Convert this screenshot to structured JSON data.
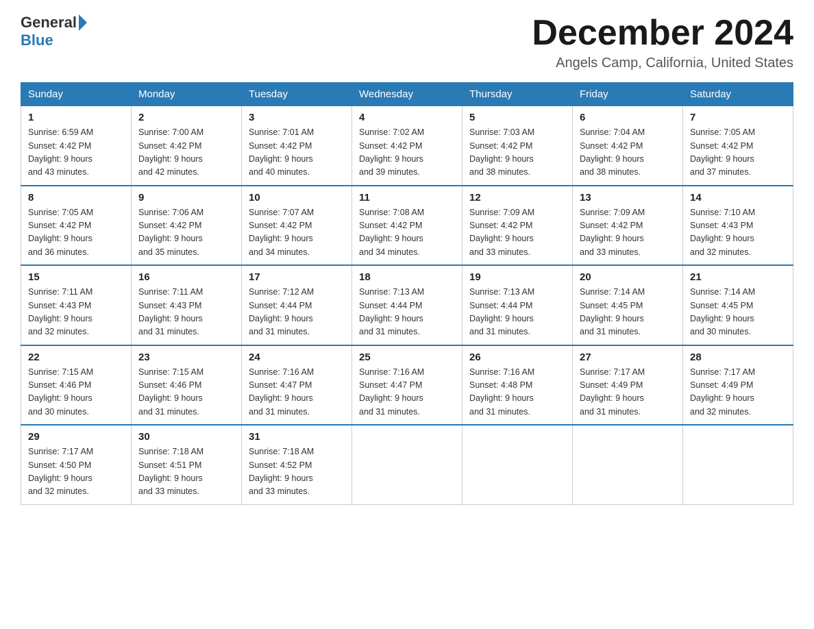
{
  "header": {
    "logo": {
      "general": "General",
      "blue": "Blue"
    },
    "title": "December 2024",
    "location": "Angels Camp, California, United States"
  },
  "days_of_week": [
    "Sunday",
    "Monday",
    "Tuesday",
    "Wednesday",
    "Thursday",
    "Friday",
    "Saturday"
  ],
  "weeks": [
    [
      {
        "day": "1",
        "sunrise": "6:59 AM",
        "sunset": "4:42 PM",
        "daylight": "9 hours and 43 minutes."
      },
      {
        "day": "2",
        "sunrise": "7:00 AM",
        "sunset": "4:42 PM",
        "daylight": "9 hours and 42 minutes."
      },
      {
        "day": "3",
        "sunrise": "7:01 AM",
        "sunset": "4:42 PM",
        "daylight": "9 hours and 40 minutes."
      },
      {
        "day": "4",
        "sunrise": "7:02 AM",
        "sunset": "4:42 PM",
        "daylight": "9 hours and 39 minutes."
      },
      {
        "day": "5",
        "sunrise": "7:03 AM",
        "sunset": "4:42 PM",
        "daylight": "9 hours and 38 minutes."
      },
      {
        "day": "6",
        "sunrise": "7:04 AM",
        "sunset": "4:42 PM",
        "daylight": "9 hours and 38 minutes."
      },
      {
        "day": "7",
        "sunrise": "7:05 AM",
        "sunset": "4:42 PM",
        "daylight": "9 hours and 37 minutes."
      }
    ],
    [
      {
        "day": "8",
        "sunrise": "7:05 AM",
        "sunset": "4:42 PM",
        "daylight": "9 hours and 36 minutes."
      },
      {
        "day": "9",
        "sunrise": "7:06 AM",
        "sunset": "4:42 PM",
        "daylight": "9 hours and 35 minutes."
      },
      {
        "day": "10",
        "sunrise": "7:07 AM",
        "sunset": "4:42 PM",
        "daylight": "9 hours and 34 minutes."
      },
      {
        "day": "11",
        "sunrise": "7:08 AM",
        "sunset": "4:42 PM",
        "daylight": "9 hours and 34 minutes."
      },
      {
        "day": "12",
        "sunrise": "7:09 AM",
        "sunset": "4:42 PM",
        "daylight": "9 hours and 33 minutes."
      },
      {
        "day": "13",
        "sunrise": "7:09 AM",
        "sunset": "4:42 PM",
        "daylight": "9 hours and 33 minutes."
      },
      {
        "day": "14",
        "sunrise": "7:10 AM",
        "sunset": "4:43 PM",
        "daylight": "9 hours and 32 minutes."
      }
    ],
    [
      {
        "day": "15",
        "sunrise": "7:11 AM",
        "sunset": "4:43 PM",
        "daylight": "9 hours and 32 minutes."
      },
      {
        "day": "16",
        "sunrise": "7:11 AM",
        "sunset": "4:43 PM",
        "daylight": "9 hours and 31 minutes."
      },
      {
        "day": "17",
        "sunrise": "7:12 AM",
        "sunset": "4:44 PM",
        "daylight": "9 hours and 31 minutes."
      },
      {
        "day": "18",
        "sunrise": "7:13 AM",
        "sunset": "4:44 PM",
        "daylight": "9 hours and 31 minutes."
      },
      {
        "day": "19",
        "sunrise": "7:13 AM",
        "sunset": "4:44 PM",
        "daylight": "9 hours and 31 minutes."
      },
      {
        "day": "20",
        "sunrise": "7:14 AM",
        "sunset": "4:45 PM",
        "daylight": "9 hours and 31 minutes."
      },
      {
        "day": "21",
        "sunrise": "7:14 AM",
        "sunset": "4:45 PM",
        "daylight": "9 hours and 30 minutes."
      }
    ],
    [
      {
        "day": "22",
        "sunrise": "7:15 AM",
        "sunset": "4:46 PM",
        "daylight": "9 hours and 30 minutes."
      },
      {
        "day": "23",
        "sunrise": "7:15 AM",
        "sunset": "4:46 PM",
        "daylight": "9 hours and 31 minutes."
      },
      {
        "day": "24",
        "sunrise": "7:16 AM",
        "sunset": "4:47 PM",
        "daylight": "9 hours and 31 minutes."
      },
      {
        "day": "25",
        "sunrise": "7:16 AM",
        "sunset": "4:47 PM",
        "daylight": "9 hours and 31 minutes."
      },
      {
        "day": "26",
        "sunrise": "7:16 AM",
        "sunset": "4:48 PM",
        "daylight": "9 hours and 31 minutes."
      },
      {
        "day": "27",
        "sunrise": "7:17 AM",
        "sunset": "4:49 PM",
        "daylight": "9 hours and 31 minutes."
      },
      {
        "day": "28",
        "sunrise": "7:17 AM",
        "sunset": "4:49 PM",
        "daylight": "9 hours and 32 minutes."
      }
    ],
    [
      {
        "day": "29",
        "sunrise": "7:17 AM",
        "sunset": "4:50 PM",
        "daylight": "9 hours and 32 minutes."
      },
      {
        "day": "30",
        "sunrise": "7:18 AM",
        "sunset": "4:51 PM",
        "daylight": "9 hours and 33 minutes."
      },
      {
        "day": "31",
        "sunrise": "7:18 AM",
        "sunset": "4:52 PM",
        "daylight": "9 hours and 33 minutes."
      },
      null,
      null,
      null,
      null
    ]
  ],
  "labels": {
    "sunrise": "Sunrise:",
    "sunset": "Sunset:",
    "daylight": "Daylight:"
  }
}
